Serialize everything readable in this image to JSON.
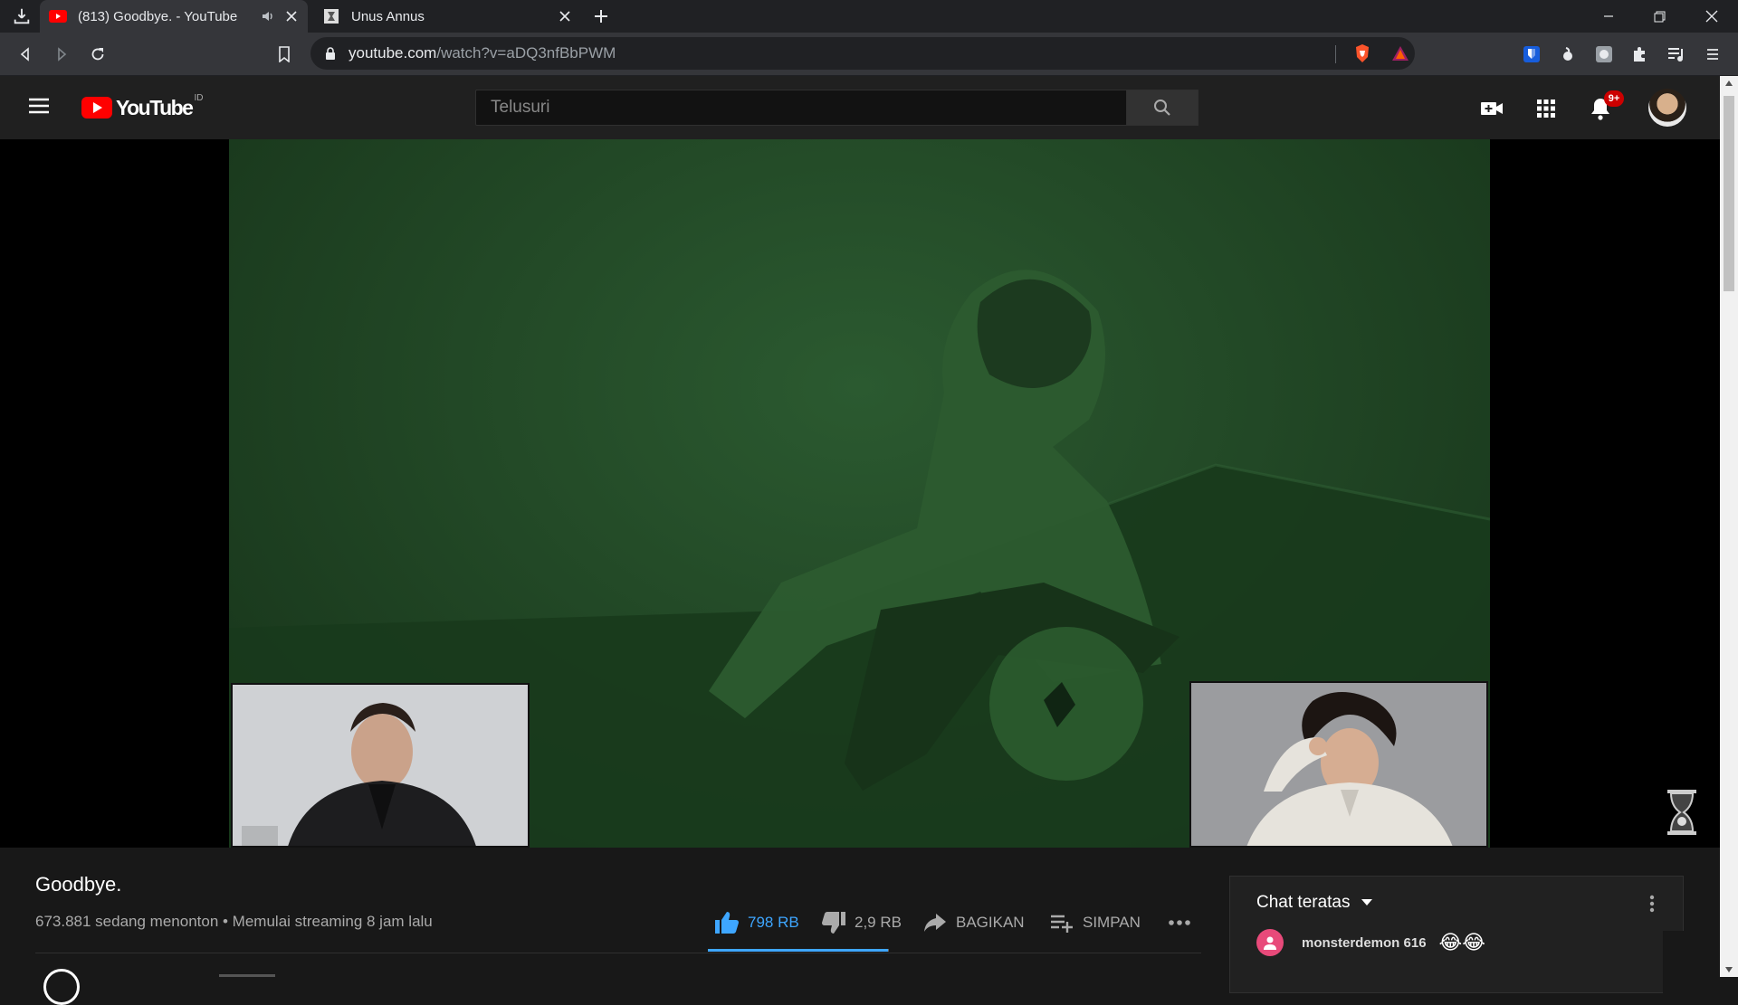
{
  "browser": {
    "tabs": [
      {
        "title": "(813) Goodbye. - YouTube",
        "active": true,
        "audio": true
      },
      {
        "title": "Unus Annus",
        "active": false
      }
    ],
    "url_host": "youtube.com",
    "url_path": "/watch?v=aDQ3nfBbPWM"
  },
  "masthead": {
    "logo_text": "YouTube",
    "country_code": "ID",
    "search_placeholder": "Telusuri",
    "notification_count": "9+"
  },
  "video": {
    "title": "Goodbye.",
    "meta": "673.881 sedang menonton • Memulai streaming 8 jam lalu",
    "like_count": "798 RB",
    "dislike_count": "2,9 RB",
    "like_ratio": 0.996,
    "share_label": "BAGIKAN",
    "save_label": "SIMPAN"
  },
  "chat": {
    "header": "Chat teratas",
    "messages": [
      {
        "author": "monsterdemon 616",
        "message": "😂😂",
        "avatar_color": "#e84a7a"
      }
    ]
  },
  "colors": {
    "yt_red": "#ff0000",
    "accent_blue": "#3ea6ff",
    "brave_orange": "#fb542b"
  }
}
